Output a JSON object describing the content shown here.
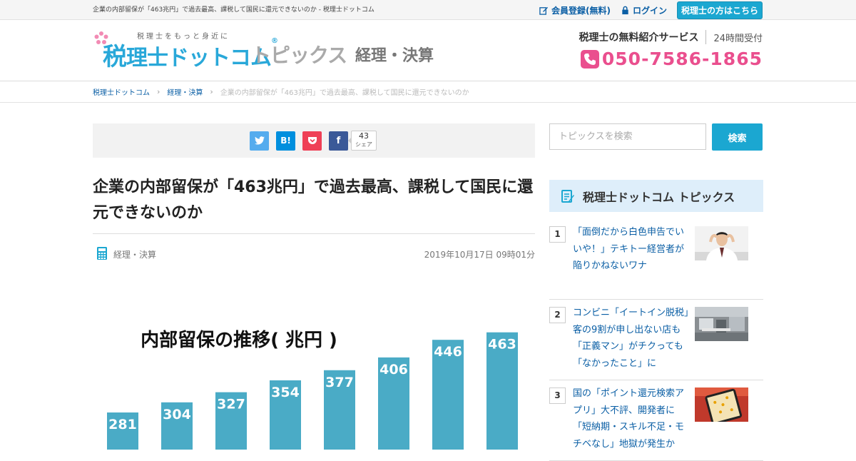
{
  "topbar": {
    "tagline": "企業の内部留保が「463兆円」で過去最高、課税して国民に還元できないのか - 税理士ドットコム",
    "register_label": "会員登録(無料)",
    "login_label": "ログイン",
    "tax_accountant_label": "税理士の方はこちら"
  },
  "header": {
    "logo_catch": "税理士をもっと身近に",
    "logo_brand_first": "税",
    "logo_brand_rest": "理士ドットコム",
    "logo_registered": "®",
    "logo_topics": "トピックス",
    "logo_category": "経理・決算",
    "service_label": "税理士の無料紹介サービス",
    "hours_label": "24時間受付",
    "phone": "050-7586-1865"
  },
  "breadcrumb": {
    "home": "税理士ドットコム",
    "category": "経理・決算",
    "current": "企業の内部留保が「463兆円」で過去最高、課税して国民に還元できないのか",
    "separator": "›"
  },
  "share": {
    "twitter_icon": "twitter-icon",
    "hatena_label": "B!",
    "pocket_icon": "pocket-icon",
    "facebook_label": "f",
    "count": "43",
    "count_label": "シェア"
  },
  "article": {
    "title": "企業の内部留保が「463兆円」で過去最高、課税して国民に還元できないのか",
    "category": "経理・決算",
    "date": "2019年10月17日 09時01分"
  },
  "chart_data": {
    "type": "bar",
    "title": "内部留保の推移( 兆円 )",
    "categories": [],
    "values": [
      281,
      304,
      327,
      354,
      377,
      406,
      446,
      463
    ],
    "bar_color": "#4aabc6",
    "xlabel": "",
    "ylabel": ""
  },
  "sidebar": {
    "search_placeholder": "トピックスを検索",
    "search_button": "検索",
    "ranking_title": "税理士ドットコム トピックス",
    "items": [
      {
        "rank": "1",
        "title": "「面倒だから白色申告でいいや！」テキトー経営者が陥りかねないワナ"
      },
      {
        "rank": "2",
        "title": "コンビニ「イートイン脱税」客の9割が申し出ない店も　「正義マン」がチクっても「なかったこと」に"
      },
      {
        "rank": "3",
        "title": "国の「ポイント還元検索アプリ」大不評、開発者に「短納期・スキル不足・モチベなし」地獄が発生か"
      }
    ]
  },
  "colors": {
    "accent": "#1ba7d1",
    "link": "#0b5fa5",
    "phone": "#ea4f8e",
    "brand": "#29a8d9"
  }
}
